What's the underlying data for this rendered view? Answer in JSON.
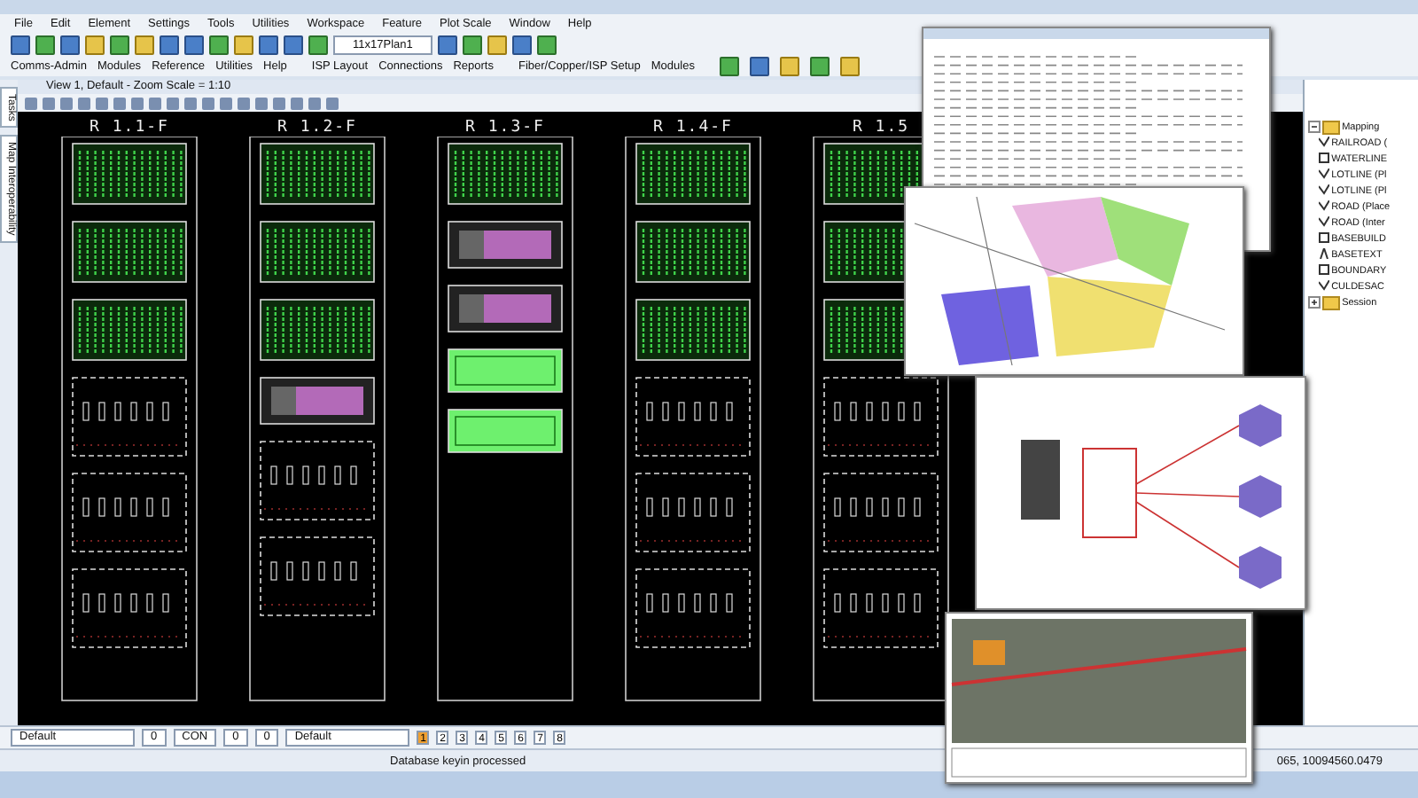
{
  "menu_bar": [
    "File",
    "Edit",
    "Element",
    "Settings",
    "Tools",
    "Utilities",
    "Workspace",
    "Feature",
    "Plot Scale",
    "Window",
    "Help"
  ],
  "toolbar": {
    "model_combo": "11x17Plan1"
  },
  "tool_menus": [
    {
      "items": [
        "Comms-Admin",
        "Modules",
        "Reference",
        "Utilities",
        "Help"
      ]
    },
    {
      "items": [
        "ISP Layout",
        "Connections",
        "Reports"
      ]
    },
    {
      "items": [
        "Fiber/Copper/ISP Setup",
        "Modules"
      ]
    }
  ],
  "view": {
    "title": "View 1, Default - Zoom Scale = 1:10",
    "side_tabs": [
      "Tasks",
      "Map Interoperability"
    ],
    "racks": [
      {
        "label": "R 1.1-F",
        "modules": [
          {
            "kind": "patch_panel"
          },
          {
            "kind": "patch_panel"
          },
          {
            "kind": "patch_panel"
          },
          {
            "kind": "chassis"
          },
          {
            "kind": "chassis"
          },
          {
            "kind": "chassis"
          }
        ]
      },
      {
        "label": "R 1.2-F",
        "modules": [
          {
            "kind": "patch_panel"
          },
          {
            "kind": "patch_panel"
          },
          {
            "kind": "patch_panel"
          },
          {
            "kind": "switch"
          },
          {
            "kind": "chassis"
          },
          {
            "kind": "chassis"
          }
        ]
      },
      {
        "label": "R 1.3-F",
        "modules": [
          {
            "kind": "patch_panel"
          },
          {
            "kind": "switch"
          },
          {
            "kind": "switch"
          },
          {
            "kind": "fiber_tray"
          },
          {
            "kind": "fiber_tray"
          }
        ]
      },
      {
        "label": "R 1.4-F",
        "modules": [
          {
            "kind": "patch_panel"
          },
          {
            "kind": "patch_panel"
          },
          {
            "kind": "patch_panel"
          },
          {
            "kind": "chassis"
          },
          {
            "kind": "chassis"
          },
          {
            "kind": "chassis"
          }
        ]
      },
      {
        "label": "R 1.5",
        "modules": [
          {
            "kind": "patch_panel"
          },
          {
            "kind": "patch_panel"
          },
          {
            "kind": "patch_panel"
          },
          {
            "kind": "chassis"
          },
          {
            "kind": "chassis"
          },
          {
            "kind": "chassis"
          }
        ]
      }
    ]
  },
  "tree": {
    "items": [
      {
        "label": "Mapping",
        "expanded": true,
        "children": [
          {
            "label": "RAILROAD (",
            "kind": "line"
          },
          {
            "label": "WATERLINE",
            "kind": "area"
          },
          {
            "label": "LOTLINE (Pl",
            "kind": "line"
          },
          {
            "label": "LOTLINE (Pl",
            "kind": "line"
          },
          {
            "label": "ROAD (Place",
            "kind": "line"
          },
          {
            "label": "ROAD (Inter",
            "kind": "line"
          },
          {
            "label": "BASEBUILD",
            "kind": "area"
          },
          {
            "label": "BASETEXT",
            "kind": "text"
          },
          {
            "label": "BOUNDARY",
            "kind": "area"
          },
          {
            "label": "CULDESAC",
            "kind": "line"
          }
        ]
      },
      {
        "label": "Session",
        "expanded": false
      }
    ]
  },
  "attributes": {
    "style": "Default",
    "color_number": "0",
    "line_style": "CON",
    "weight": "0",
    "transparency": "0",
    "template": "Default",
    "views": [
      {
        "label": "1",
        "selected": true
      },
      {
        "label": "2",
        "selected": false
      },
      {
        "label": "3",
        "selected": false
      },
      {
        "label": "4",
        "selected": false
      },
      {
        "label": "5",
        "selected": false
      },
      {
        "label": "6",
        "selected": false
      },
      {
        "label": "7",
        "selected": false
      },
      {
        "label": "8",
        "selected": false
      }
    ]
  },
  "status_bar": {
    "message": "Database keyin processed",
    "coordinates": "065, 10094560.0479"
  }
}
